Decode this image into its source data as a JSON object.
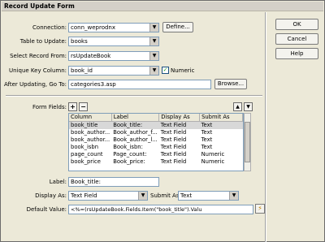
{
  "window": {
    "title": "Record Update Form"
  },
  "form": {
    "connection_label": "Connection:",
    "connection_value": "conn_weprodnx",
    "define_button": "Define...",
    "table_label": "Table to Update:",
    "table_value": "books",
    "select_record_label": "Select Record From:",
    "select_record_value": "rsUpdateBook",
    "unique_key_label": "Unique Key Column:",
    "unique_key_value": "book_id",
    "numeric_label": "Numeric",
    "after_updating_label": "After Updating, Go To:",
    "after_updating_value": "categories3.asp",
    "browse_button": "Browse...",
    "form_fields_label": "Form Fields:",
    "add_symbol": "+",
    "remove_symbol": "−",
    "up_symbol": "▲",
    "down_symbol": "▼",
    "label_label": "Label:",
    "label_value": "Book_title:",
    "display_as_label": "Display As:",
    "display_as_value": "Text Field",
    "submit_as_label": "Submit As:",
    "submit_as_value": "Text",
    "default_value_label": "Default Value:",
    "default_value_value": "<%=(rsUpdateBook.Fields.Item(\"book_title\").Valu"
  },
  "grid": {
    "columns": [
      "Column",
      "Label",
      "Display As",
      "Submit As"
    ],
    "rows": [
      [
        "book_title",
        "Book_title:",
        "Text Field",
        "Text"
      ],
      [
        "book_author...",
        "Book_author_f...",
        "Text Field",
        "Text"
      ],
      [
        "book_author...",
        "Book_author_l...",
        "Text Field",
        "Text"
      ],
      [
        "book_isbn",
        "Book_isbn:",
        "Text Field",
        "Text"
      ],
      [
        "page_count",
        "Page_count:",
        "Text Field",
        "Numeric"
      ],
      [
        "book_price",
        "Book_price:",
        "Text Field",
        "Numeric"
      ]
    ],
    "selected_row": 0
  },
  "side_buttons": {
    "ok": "OK",
    "cancel": "Cancel",
    "help": "Help"
  },
  "icons": {
    "dropdown": "chevron-down-icon",
    "check": "checkmark-icon",
    "dynamic": "lightning-icon"
  }
}
